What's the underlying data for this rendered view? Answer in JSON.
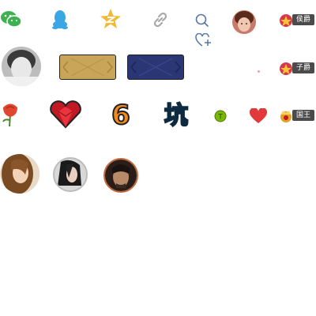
{
  "icons": {
    "row1": [
      "wechat-icon",
      "qq-icon",
      "qzone-star-icon",
      "link-icon",
      "search-icon",
      "heart-plus-icon"
    ],
    "row3": [
      "rose-icon",
      "gem-heart-icon",
      "number-six-icon",
      "keng-text-icon",
      "green-coin-icon",
      "red-heart-icon"
    ]
  },
  "keng_text": "坑",
  "six_text": "6",
  "ranks": [
    {
      "label": "侯爵"
    },
    {
      "label": "子爵"
    },
    {
      "label": "国王"
    }
  ],
  "colors": {
    "wechat": "#3fb04f",
    "qq": "#3aa6e6",
    "qzone": "#f4b934",
    "link_gray": "#a8a8a8",
    "search_blue": "#5577aa",
    "gold_card": "#c9a55a",
    "blue_card": "#2b3775",
    "rank_bg": "#4b4b4b",
    "heart_red": "#e03a3a",
    "coin_green": "#7ab800"
  }
}
